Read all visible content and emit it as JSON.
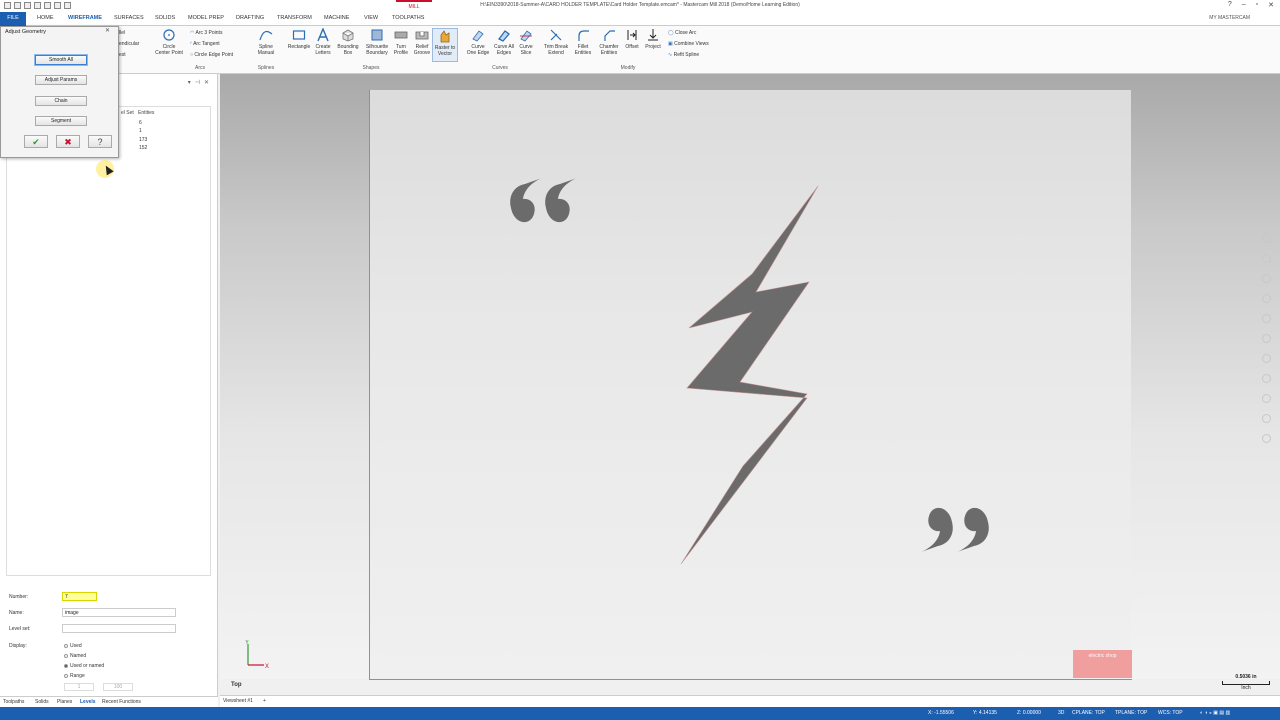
{
  "window": {
    "title": "H:\\EIN3390\\2018-Summer-A\\CARD HOLDER TEMPLATE\\Card Holder Template.emcam* - Mastercam Mill 2018 (Demo/Home Learning Edition)",
    "context_tab": "MILL",
    "my_mastercam": "MY MASTERCAM"
  },
  "tabs": [
    "FILE",
    "HOME",
    "WIREFRAME",
    "SURFACES",
    "SOLIDS",
    "MODEL PREP",
    "DRAFTING",
    "TRANSFORM",
    "MACHINE",
    "VIEW",
    "TOOLPATHS"
  ],
  "ribbon": {
    "arcs": {
      "circle_center_point": "Circle\nCenter Point",
      "arc_3_points": "Arc 3 Points",
      "arc_tangent": "Arc Tangent",
      "circle_edge_point": "Circle Edge Point",
      "partial_left_1": "llel",
      "partial_left_2": "endicular",
      "partial_left_3": "est",
      "group": "Arcs"
    },
    "splines": {
      "spline_manual": "Spline\nManual",
      "group": "Splines"
    },
    "shapes": {
      "rectangle": "Rectangle",
      "create_letters": "Create\nLetters",
      "bounding_box": "Bounding\nBox",
      "silhouette_boundary": "Silhouette\nBoundary",
      "turn_profile": "Turn\nProfile",
      "relief_groove": "Relief\nGroove",
      "raster_to_vector": "Raster to\nVector",
      "group": "Shapes"
    },
    "curves": {
      "curve_one_edge": "Curve\nOne Edge",
      "curve_all_edges": "Curve All\nEdges",
      "curve_slice": "Curve\nSlice",
      "group": "Curves"
    },
    "modify": {
      "trim_break_extend": "Trim Break\nExtend",
      "fillet_entities": "Fillet\nEntities",
      "chamfer_entities": "Chamfer\nEntities",
      "offset": "Offset",
      "project": "Project",
      "close_arc": "Close Arc",
      "combine_views": "Combine Views",
      "refit_spline": "Refit Spline",
      "group": "Modify"
    }
  },
  "dialog": {
    "title": "Adjust Geometry",
    "buttons": [
      "Smooth All",
      "Adjust Params",
      "Chain",
      "Segment"
    ]
  },
  "levels": {
    "headers": {
      "set": "el Set",
      "entities": "Entities"
    },
    "entities": [
      "6",
      "1",
      "173",
      "152"
    ],
    "form": {
      "number_label": "Number:",
      "number_value": "7",
      "name_label": "Name:",
      "name_value": "image",
      "level_set_label": "Level set:",
      "level_set_value": "",
      "display_label": "Display:",
      "display_options": [
        "Used",
        "Named",
        "Used or named",
        "Range"
      ],
      "range_from": "1",
      "range_to": "100"
    }
  },
  "manager_tabs": [
    "Toolpaths",
    "Solids",
    "Planes",
    "Levels",
    "Recent Functions"
  ],
  "viewport": {
    "view_name": "Top",
    "scale_value": "0.5036 in",
    "scale_unit": "Inch",
    "axis_x": "X",
    "axis_y": "Y",
    "watermark": "electric shop"
  },
  "sheets": {
    "tab": "Viewsheet #1",
    "add": "+"
  },
  "status": {
    "x": "X: -1.55506",
    "y": "Y: 4.14135",
    "z": "Z: 0.00000",
    "mode": "3D",
    "cplane": "CPLANE: TOP",
    "tplane": "TPLANE: TOP",
    "wcs": "WCS: TOP"
  },
  "colors": {
    "accent": "#1c5fb0",
    "mill_tab": "#c8102e",
    "shape_fill": "#6b6b6b",
    "card_edge": "#e07070",
    "level_number_bg": "#ffff99"
  }
}
